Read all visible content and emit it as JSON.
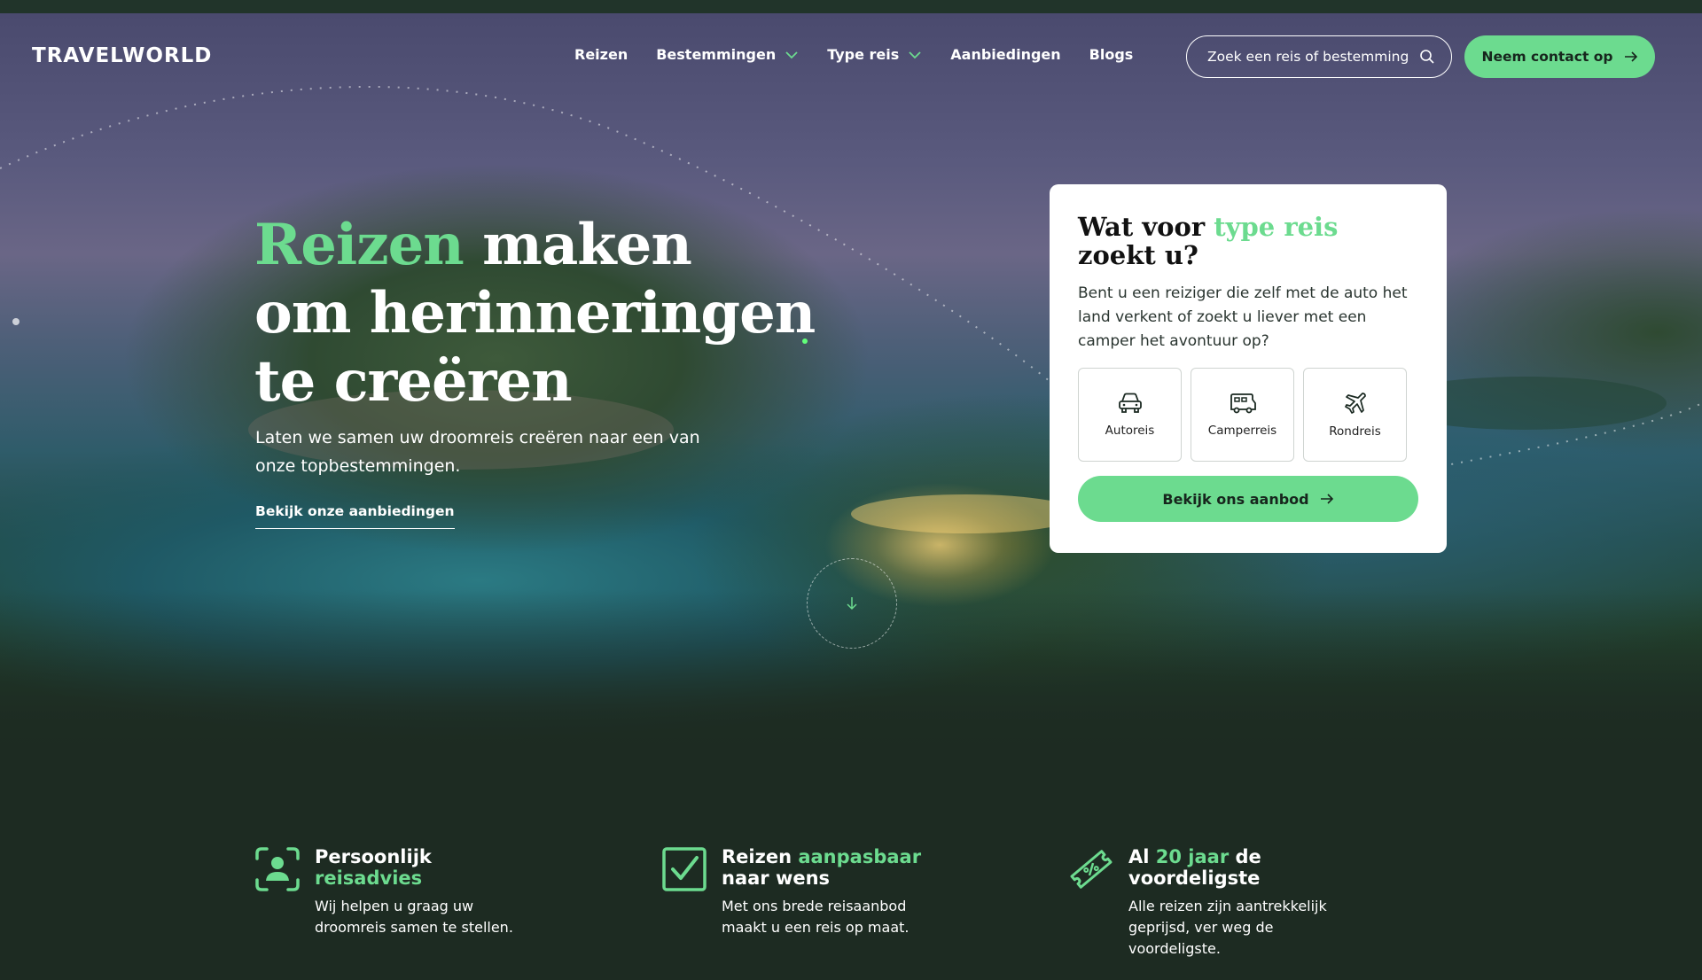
{
  "header": {
    "logo": "TRAVELWORLD",
    "nav": [
      {
        "label": "Reizen",
        "has_dropdown": false
      },
      {
        "label": "Bestemmingen",
        "has_dropdown": true
      },
      {
        "label": "Type reis",
        "has_dropdown": true
      },
      {
        "label": "Aanbiedingen",
        "has_dropdown": false
      },
      {
        "label": "Blogs",
        "has_dropdown": false
      }
    ],
    "search_placeholder": "Zoek een reis of bestemming",
    "contact_label": "Neem contact op"
  },
  "hero": {
    "headline_accent": "Reizen",
    "headline_line1_rest": " maken",
    "headline_line2": "om herinneringen",
    "headline_line3": "te creëren",
    "subtext": "Laten we samen uw droomreis creëren naar een van onze topbestemmingen.",
    "cta_link": "Bekijk onze aanbiedingen"
  },
  "card": {
    "title_prefix": "Wat voor ",
    "title_accent": "type reis",
    "title_line2": "zoekt u?",
    "description": "Bent u een reiziger die zelf met de auto het land verkent of zoekt u liever met een camper het avontuur op?",
    "options": [
      {
        "label": "Autoreis",
        "icon": "car-icon"
      },
      {
        "label": "Camperreis",
        "icon": "camper-icon"
      },
      {
        "label": "Rondreis",
        "icon": "plane-icon"
      }
    ],
    "button_label": "Bekijk ons aanbod"
  },
  "features": [
    {
      "title_plain": "Persoonlijk",
      "title_accent": "reisadvies",
      "description": "Wij helpen u graag uw droomreis samen te stellen.",
      "icon": "person-focus-icon"
    },
    {
      "title_plain": "Reizen ",
      "title_accent": "aanpasbaar",
      "title_line2": "naar wens",
      "description": "Met ons brede reisaanbod maakt u een reis op maat.",
      "icon": "checkbox-icon"
    },
    {
      "title_prefix": "Al ",
      "title_accent": "20 jaar",
      "title_suffix": " de",
      "title_line2": "voordeligste",
      "description": "Alle reizen zijn aantrekkelijk geprijsd, ver weg de voordeligste.",
      "icon": "discount-ticket-icon"
    }
  ],
  "colors": {
    "accent": "#6cdb8f",
    "dark_green": "#1d2b22"
  }
}
